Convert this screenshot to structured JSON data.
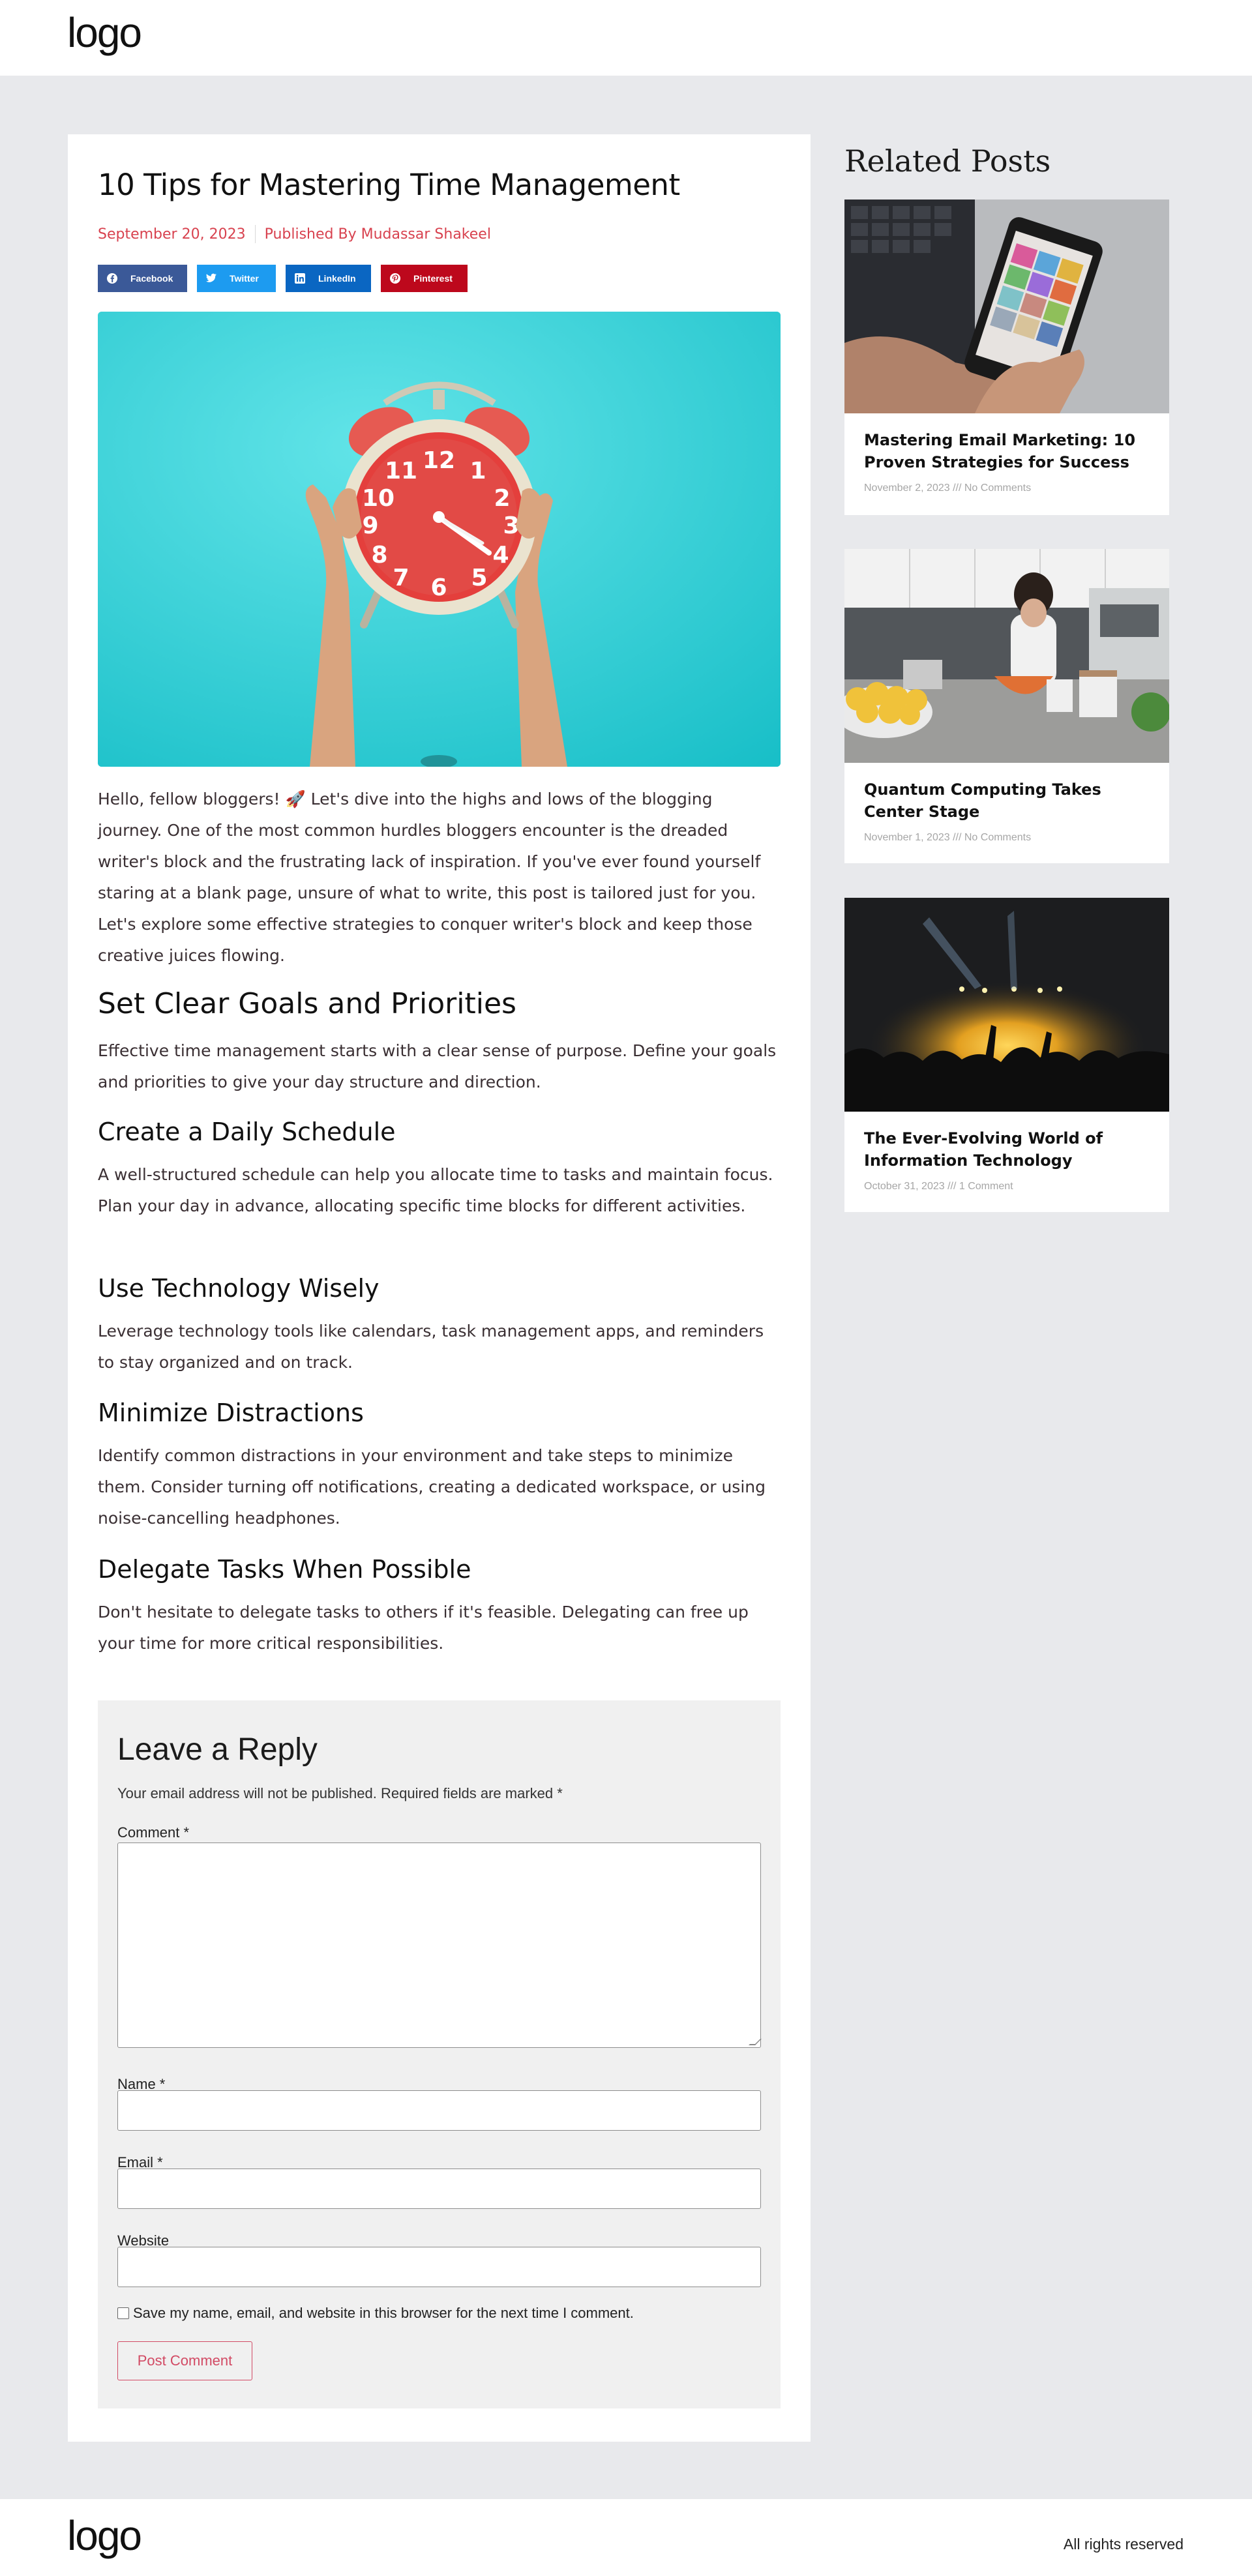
{
  "header": {
    "logo": "logo"
  },
  "article": {
    "title": "10 Tips for Mastering Time Management",
    "date": "September 20, 2023",
    "author": "Published By Mudassar Shakeel",
    "share": [
      {
        "label": "Facebook",
        "color": "#3b5998",
        "icon": "facebook-icon"
      },
      {
        "label": "Twitter",
        "color": "#1d9bf0",
        "icon": "twitter-icon"
      },
      {
        "label": "LinkedIn",
        "color": "#0a66c2",
        "icon": "linkedin-icon"
      },
      {
        "label": "Pinterest",
        "color": "#bd081c",
        "icon": "pinterest-icon"
      }
    ],
    "intro": "Hello, fellow bloggers! 🚀 Let's dive into the highs and lows of the blogging journey. One of the most common hurdles bloggers encounter is the dreaded writer's block and the frustrating lack of inspiration. If you've ever found yourself staring at a blank page, unsure of what to write, this post is tailored just for you. Let's explore some effective strategies to conquer writer's block and keep those creative juices flowing.",
    "sections": [
      {
        "heading": "Set Clear Goals and Priorities",
        "text": "Effective time management starts with a clear sense of purpose. Define your goals and priorities to give your day structure and direction."
      },
      {
        "heading": "Create a Daily Schedule",
        "text": "A well-structured schedule can help you allocate time to tasks and maintain focus. Plan your day in advance, allocating specific time blocks for different activities."
      },
      {
        "heading": "Use Technology Wisely",
        "text": "Leverage technology tools like calendars, task management apps, and reminders to stay organized and on track."
      },
      {
        "heading": "Minimize Distractions",
        "text": "Identify common distractions in your environment and take steps to minimize them. Consider turning off notifications, creating a dedicated workspace, or using noise-cancelling headphones."
      },
      {
        "heading": "Delegate Tasks When Possible",
        "text": "Don't hesitate to delegate tasks to others if it's feasible. Delegating can free up your time for more critical responsibilities."
      }
    ]
  },
  "reply": {
    "title": "Leave a Reply",
    "notice": "Your email address will not be published. Required fields are marked *",
    "comment_label": "Comment *",
    "name_label": "Name *",
    "email_label": "Email *",
    "website_label": "Website",
    "consent": "Save my name, email, and website in this browser for the next time I comment.",
    "submit": "Post Comment"
  },
  "sidebar": {
    "title": "Related Posts",
    "posts": [
      {
        "title": "Mastering Email Marketing: 10 Proven Strategies for Success",
        "meta": "November 2, 2023 /// No Comments"
      },
      {
        "title": "Quantum Computing Takes Center Stage",
        "meta": "November 1, 2023 /// No Comments"
      },
      {
        "title": "The Ever-Evolving World of Information Technology",
        "meta": "October 31, 2023 /// 1 Comment"
      }
    ]
  },
  "footer": {
    "logo": "logo",
    "rights": "All rights reserved"
  }
}
